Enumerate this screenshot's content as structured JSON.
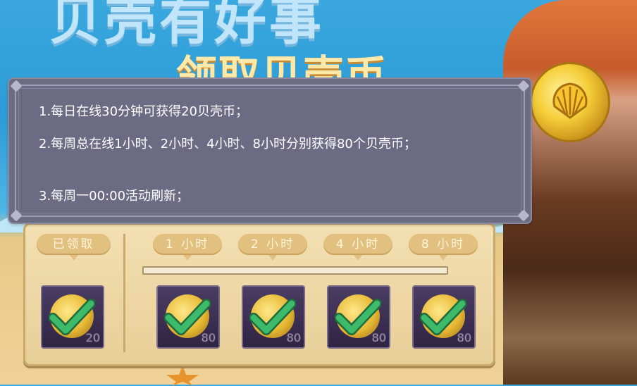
{
  "background": {
    "title_top": "贝壳有好事",
    "title_sub": "领取贝壳币"
  },
  "tooltip": {
    "lines": [
      "1.每日在线30分钟可获得20贝壳币；",
      "2.每周总在线1小时、2小时、4小时、8小时分别获得80个贝壳币；",
      "3.每周一00:00活动刷新；"
    ]
  },
  "reward_panel": {
    "daily": {
      "label": "已领取",
      "amount": "20",
      "claimed": true
    },
    "weekly_progress": 0.0,
    "weekly": [
      {
        "label": "1 小时",
        "amount": "80",
        "claimed": true
      },
      {
        "label": "2 小时",
        "amount": "80",
        "claimed": true
      },
      {
        "label": "4 小时",
        "amount": "80",
        "claimed": true
      },
      {
        "label": "8 小时",
        "amount": "80",
        "claimed": true
      }
    ]
  },
  "colors": {
    "tooltip_bg": "#6c6b84",
    "check_green": "#3dbb6a",
    "panel_bg": "#f3dfb2"
  },
  "icons": [
    "shell-coin-icon",
    "checkmark-icon"
  ]
}
